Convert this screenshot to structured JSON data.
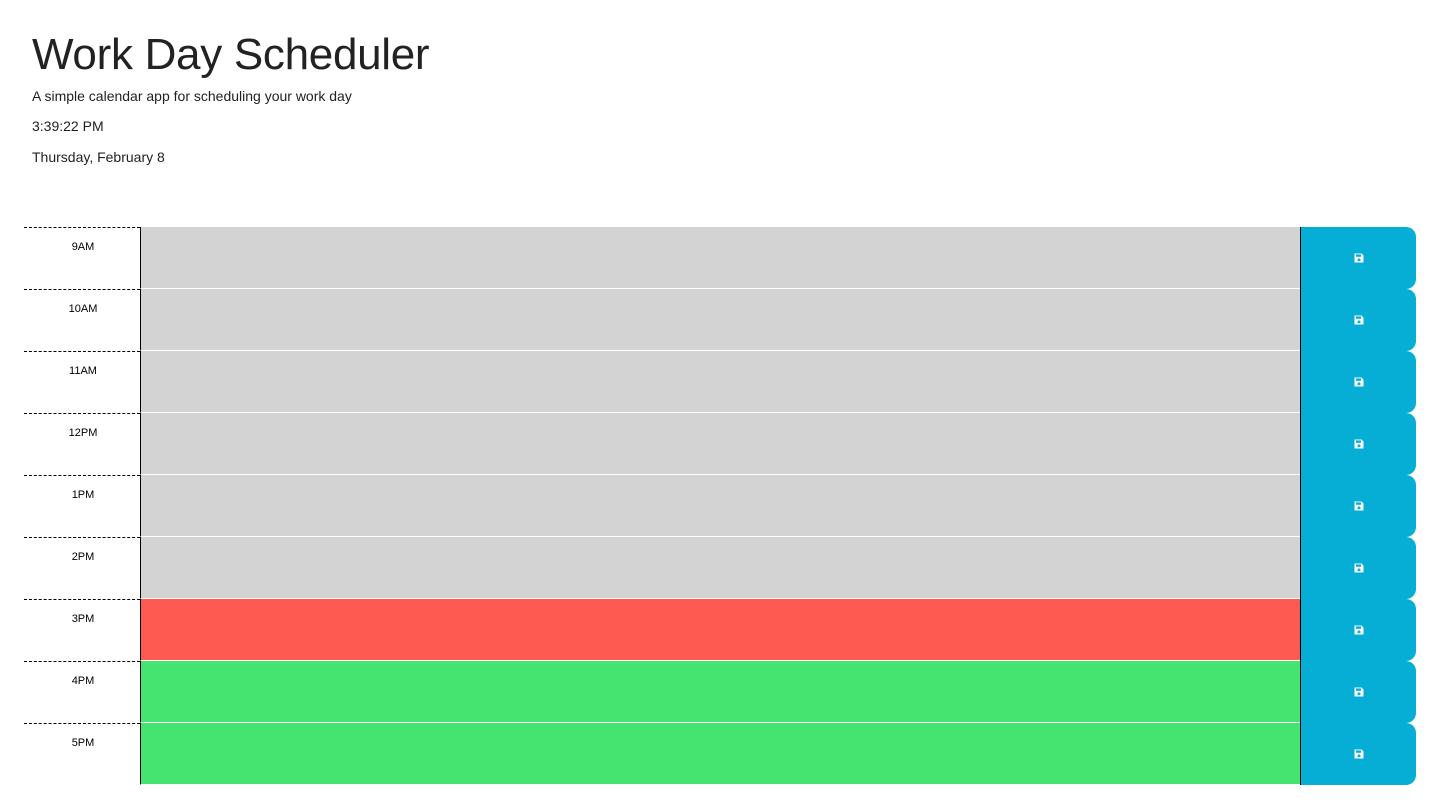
{
  "header": {
    "title": "Work Day Scheduler",
    "subtitle": "A simple calendar app for scheduling your work day",
    "time": "3:39:22 PM",
    "date": "Thursday, February 8"
  },
  "colors": {
    "past": "#d3d3d3",
    "present": "#ff5a52",
    "future": "#45e36f",
    "save_button": "#06aed5"
  },
  "rows": [
    {
      "hour": "9AM",
      "state": "past",
      "text": "",
      "save_icon": "save-icon"
    },
    {
      "hour": "10AM",
      "state": "past",
      "text": "",
      "save_icon": "save-icon"
    },
    {
      "hour": "11AM",
      "state": "past",
      "text": "",
      "save_icon": "save-icon"
    },
    {
      "hour": "12PM",
      "state": "past",
      "text": "",
      "save_icon": "save-icon"
    },
    {
      "hour": "1PM",
      "state": "past",
      "text": "",
      "save_icon": "save-icon"
    },
    {
      "hour": "2PM",
      "state": "past",
      "text": "",
      "save_icon": "save-icon"
    },
    {
      "hour": "3PM",
      "state": "present",
      "text": "",
      "save_icon": "save-icon"
    },
    {
      "hour": "4PM",
      "state": "future",
      "text": "",
      "save_icon": "save-icon"
    },
    {
      "hour": "5PM",
      "state": "future",
      "text": "",
      "save_icon": "save-icon"
    }
  ]
}
